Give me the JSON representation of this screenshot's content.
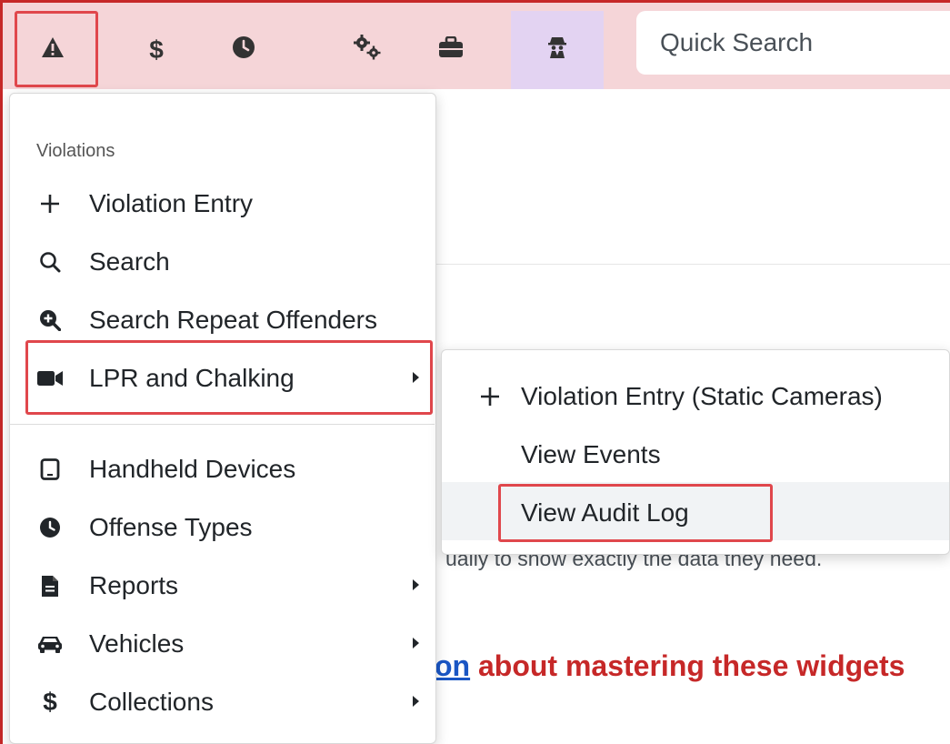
{
  "toolbar": {
    "icons": [
      "warning-icon",
      "dollar-icon",
      "clock-icon",
      "gears-icon",
      "briefcase-icon",
      "user-secret-icon"
    ],
    "dollar_glyph": "$",
    "search_placeholder": "Quick Search"
  },
  "background": {
    "line_text": "ually to show exactly the data they need.",
    "heading_link": "on",
    "heading_rest": " about mastering these widgets"
  },
  "menu": {
    "header": "Violations",
    "items": [
      {
        "label": "Violation Entry",
        "icon": "plus-icon"
      },
      {
        "label": "Search",
        "icon": "search-icon"
      },
      {
        "label": "Search Repeat Offenders",
        "icon": "search-plus-icon"
      },
      {
        "label": "LPR and Chalking",
        "icon": "video-camera-icon",
        "submenu": true
      },
      {
        "label": "Handheld Devices",
        "icon": "tablet-icon"
      },
      {
        "label": "Offense Types",
        "icon": "clock-icon"
      },
      {
        "label": "Reports",
        "icon": "file-icon",
        "submenu": true
      },
      {
        "label": "Vehicles",
        "icon": "car-icon",
        "submenu": true
      },
      {
        "label": "Collections",
        "icon": "dollar-icon",
        "submenu": true,
        "glyph": "$"
      }
    ]
  },
  "submenu": {
    "items": [
      {
        "label": "Violation Entry (Static Cameras)",
        "icon": "plus-icon"
      },
      {
        "label": "View Events"
      },
      {
        "label": "View Audit Log"
      }
    ]
  },
  "colors": {
    "toolbar_bg": "#f5d5d8",
    "active_tab_bg": "#e3d3f2",
    "highlight_red": "#e0474c",
    "heading_red": "#c62828",
    "link_blue": "#1a56c4"
  }
}
